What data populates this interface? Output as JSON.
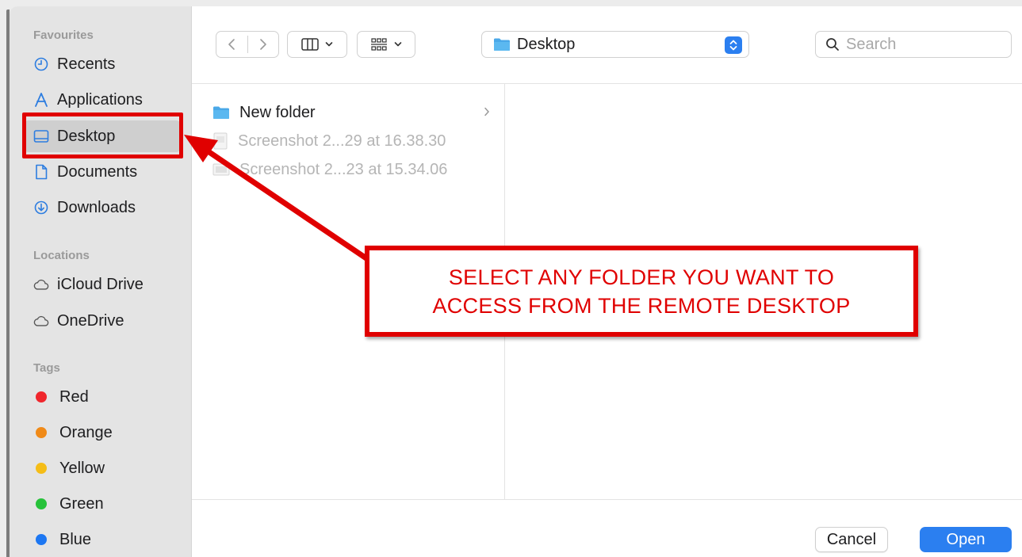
{
  "sidebar": {
    "favourites_header": "Favourites",
    "favourites": [
      {
        "label": "Recents",
        "icon": "clock-icon"
      },
      {
        "label": "Applications",
        "icon": "applications-icon"
      },
      {
        "label": "Desktop",
        "icon": "desktop-icon",
        "selected": true
      },
      {
        "label": "Documents",
        "icon": "document-icon"
      },
      {
        "label": "Downloads",
        "icon": "download-icon"
      }
    ],
    "locations_header": "Locations",
    "locations": [
      {
        "label": "iCloud Drive",
        "icon": "cloud-icon"
      },
      {
        "label": "OneDrive",
        "icon": "cloud-icon"
      }
    ],
    "tags_header": "Tags",
    "tags": [
      {
        "label": "Red",
        "color": "#f0262c"
      },
      {
        "label": "Orange",
        "color": "#f08a18"
      },
      {
        "label": "Yellow",
        "color": "#f5bd17"
      },
      {
        "label": "Green",
        "color": "#27c23a"
      },
      {
        "label": "Blue",
        "color": "#1d77f2"
      }
    ]
  },
  "toolbar": {
    "location_label": "Desktop",
    "search_placeholder": "Search"
  },
  "files": [
    {
      "name": "New folder",
      "type": "folder",
      "dimmed": false
    },
    {
      "name": "Screenshot 2...29 at 16.38.30",
      "type": "image",
      "dimmed": true
    },
    {
      "name": "Screenshot 2...23 at 15.34.06",
      "type": "image",
      "dimmed": true
    }
  ],
  "footer": {
    "cancel_label": "Cancel",
    "open_label": "Open"
  },
  "annotation": {
    "line1": "SELECT ANY FOLDER YOU WANT TO",
    "line2": "ACCESS FROM THE REMOTE DESKTOP",
    "color": "#e00000"
  },
  "colors": {
    "accent": "#2b7ff0",
    "folder": "#4aa8e8"
  }
}
